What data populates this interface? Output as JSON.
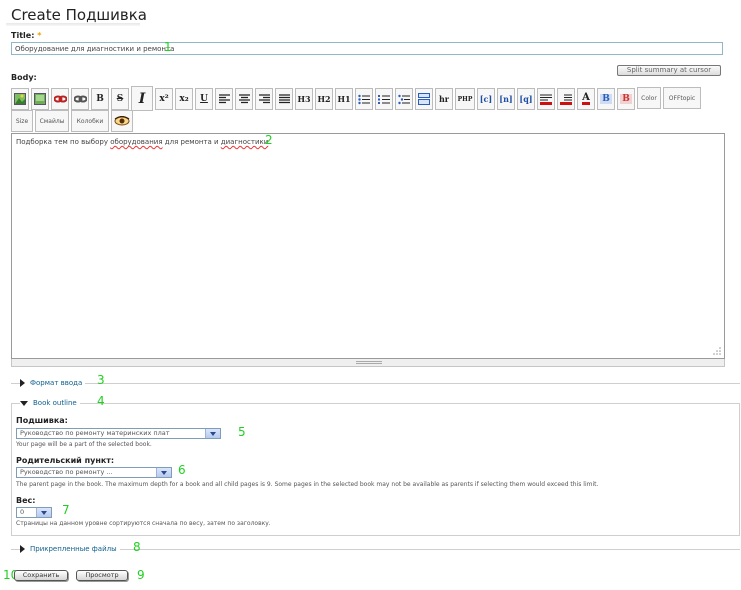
{
  "page": {
    "title": "Create Подшивка"
  },
  "title_field": {
    "label": "Title:",
    "required_mark": "*",
    "value": "Оборудование для диагностики и ремонта"
  },
  "body_field": {
    "label": "Body:",
    "split_button": "Split summary at cursor",
    "editor_text_before": "Подборка тем по выбору ",
    "editor_text_misspelled_1": "оборудования",
    "editor_text_middle": " для ремонта и ",
    "editor_text_misspelled_2": "диагностики",
    "editor_text_after": "."
  },
  "toolbar": {
    "buttons": [
      {
        "name": "image-icon"
      },
      {
        "name": "image-alt-icon"
      },
      {
        "name": "link-icon"
      },
      {
        "name": "unlink-icon"
      },
      {
        "name": "bold-icon",
        "label": "B"
      },
      {
        "name": "strike-icon",
        "label": "S"
      },
      {
        "name": "italic-icon",
        "label": "I"
      },
      {
        "name": "superscript-icon",
        "label": "x²"
      },
      {
        "name": "subscript-icon",
        "label": "x₂"
      },
      {
        "name": "underline-icon",
        "label": "U"
      },
      {
        "name": "align-left-icon"
      },
      {
        "name": "align-center-icon"
      },
      {
        "name": "align-right-icon"
      },
      {
        "name": "justify-icon"
      },
      {
        "name": "h3-icon",
        "label": "H3"
      },
      {
        "name": "h2-icon",
        "label": "H2"
      },
      {
        "name": "h1-icon",
        "label": "H1"
      },
      {
        "name": "bulleted-list-icon"
      },
      {
        "name": "numbered-list-icon"
      },
      {
        "name": "nested-list-icon"
      },
      {
        "name": "block-icon"
      },
      {
        "name": "hr-icon",
        "label": "hr"
      },
      {
        "name": "php-icon",
        "label": "PHP"
      },
      {
        "name": "code-c-icon",
        "label": "[c]"
      },
      {
        "name": "code-n-icon",
        "label": "[n]"
      },
      {
        "name": "code-q-icon",
        "label": "[q]"
      },
      {
        "name": "color-block-icon"
      },
      {
        "name": "color-block-2-icon"
      },
      {
        "name": "font-color-icon",
        "label": "A"
      },
      {
        "name": "bold-blue-icon",
        "label": "B"
      },
      {
        "name": "bold-red-icon",
        "label": "B"
      }
    ],
    "color_button": "Color",
    "offtopic_button": "OFFtopic",
    "size_button": "Size",
    "smileys_button": "Смайлы",
    "colobki_button": "Колобки",
    "eye_button": "preview-eye-icon"
  },
  "annotations": {
    "n1": "1",
    "n2": "2",
    "n3": "3",
    "n4": "4",
    "n5": "5",
    "n6": "6",
    "n7": "7",
    "n8": "8",
    "n9": "9",
    "n10": "10"
  },
  "input_format": {
    "legend": "Формат ввода"
  },
  "book_outline": {
    "legend": "Book outline",
    "book_label": "Подшивка:",
    "book_value": "Руководство по ремонту материнских плат",
    "book_help": "Your page will be a part of the selected book.",
    "parent_label": "Родительский пункт:",
    "parent_value": "Руководство по ремонту ...",
    "parent_help": "The parent page in the book. The maximum depth for a book and all child pages is 9. Some pages in the selected book may not be available as parents if selecting them would exceed this limit.",
    "weight_label": "Вес:",
    "weight_value": "0",
    "weight_help": "Страницы на данном уровне сортируются сначала по весу, затем по заголовку."
  },
  "attachments": {
    "legend": "Прикрепленные файлы"
  },
  "actions": {
    "save": "Сохранить",
    "preview": "Просмотр"
  },
  "colors": {
    "accent_green": "#1fd11f",
    "legend_link": "#0e5f8d"
  }
}
